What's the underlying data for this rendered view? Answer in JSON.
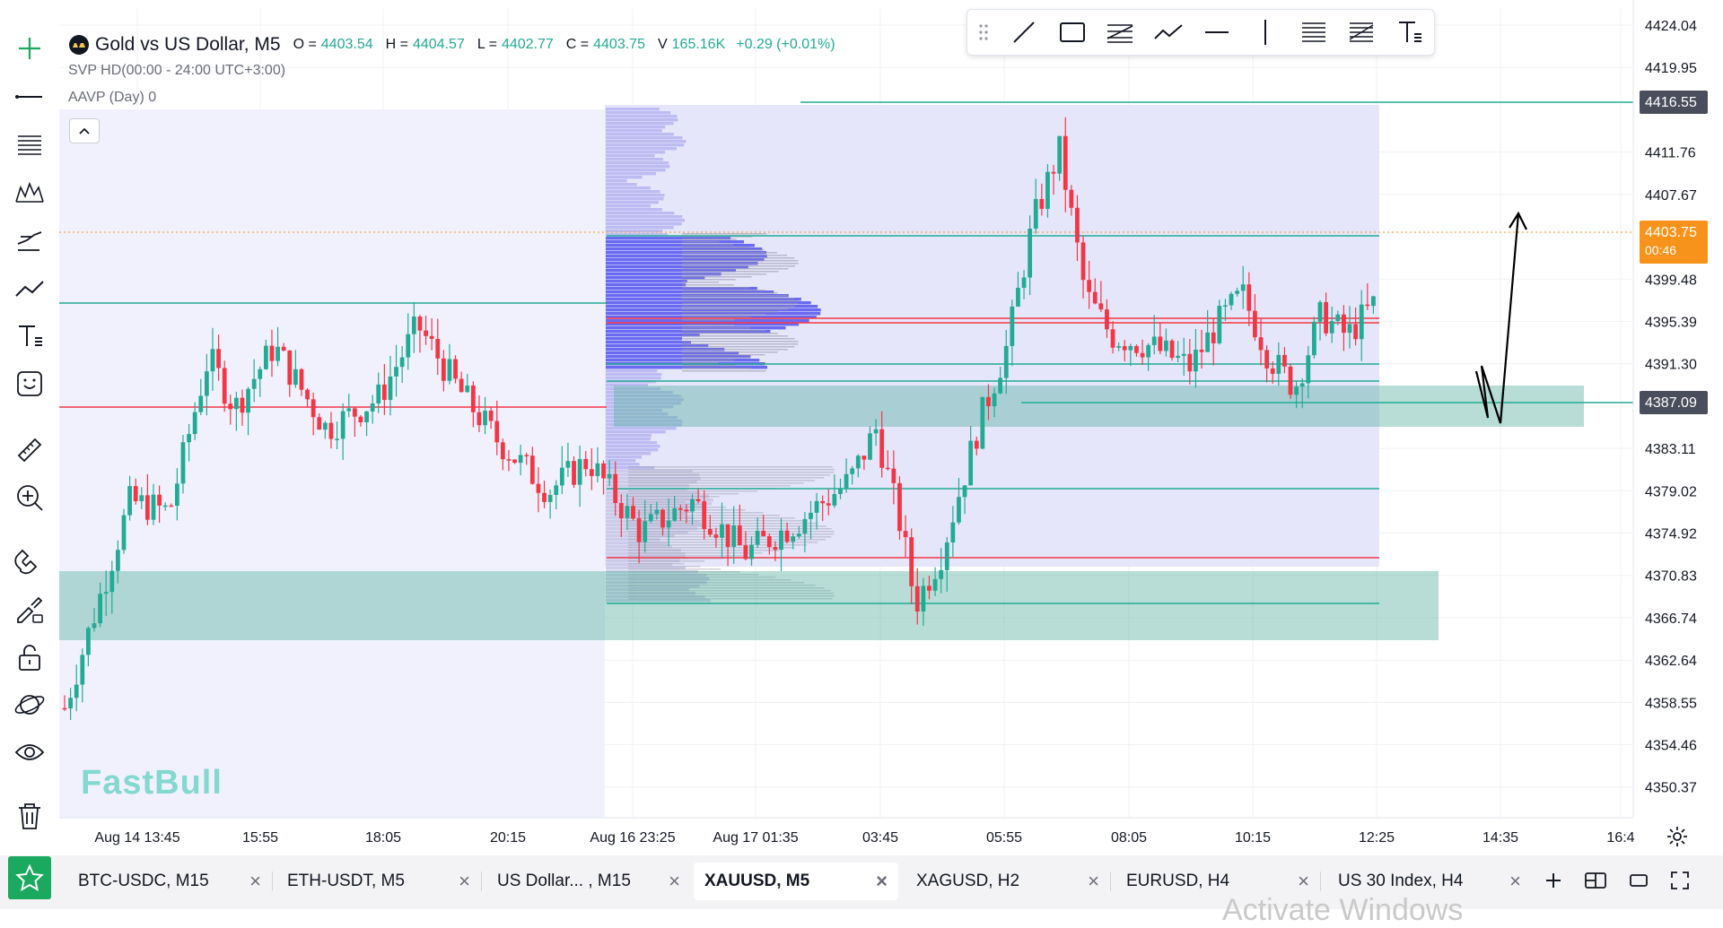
{
  "header": {
    "title": "Gold vs US Dollar, M5",
    "ohlc": [
      {
        "label": "O =",
        "value": "4403.54"
      },
      {
        "label": "H =",
        "value": "4404.57"
      },
      {
        "label": "L =",
        "value": "4402.77"
      },
      {
        "label": "C =",
        "value": "4403.75"
      },
      {
        "label": "V",
        "value": "165.16K"
      }
    ],
    "change": "+0.29 (+0.01%)",
    "indicators": [
      "SVP HD(00:00 - 24:00 UTC+3:00)",
      "AAVP (Day)  0"
    ]
  },
  "chart_data": {
    "type": "candlestick",
    "title": "Gold vs US Dollar, M5",
    "symbol": "XAUUSD",
    "timeframe": "M5",
    "y_ticks": [
      "4424.04",
      "4419.95",
      "4411.76",
      "4407.67",
      "4399.48",
      "4395.39",
      "4391.30",
      "4383.11",
      "4379.02",
      "4374.92",
      "4370.83",
      "4366.74",
      "4362.64",
      "4358.55",
      "4354.46",
      "4350.37"
    ],
    "x_ticks": [
      "Aug 14 13:45",
      "15:55",
      "18:05",
      "20:15",
      "Aug 16 23:25",
      "Aug 17 01:35",
      "03:45",
      "05:55",
      "08:05",
      "10:15",
      "12:25",
      "14:35",
      "16:4"
    ],
    "price_labels": [
      {
        "value": "4416.55",
        "color": "#4a4e5c"
      },
      {
        "value": "4403.75",
        "sub": "00:46",
        "color": "#f7931a"
      },
      {
        "value": "4387.09",
        "color": "#4a4e5c"
      }
    ],
    "ylim": [
      4347.4,
      4425.6
    ],
    "candles_approx": [
      {
        "x": 0.0,
        "price": 4358
      },
      {
        "x": 0.02,
        "price": 4366
      },
      {
        "x": 0.05,
        "price": 4378
      },
      {
        "x": 0.08,
        "price": 4377
      },
      {
        "x": 0.11,
        "price": 4392
      },
      {
        "x": 0.13,
        "price": 4387
      },
      {
        "x": 0.16,
        "price": 4393
      },
      {
        "x": 0.2,
        "price": 4385
      },
      {
        "x": 0.24,
        "price": 4388
      },
      {
        "x": 0.27,
        "price": 4395
      },
      {
        "x": 0.3,
        "price": 4389
      },
      {
        "x": 0.33,
        "price": 4384
      },
      {
        "x": 0.37,
        "price": 4379
      },
      {
        "x": 0.4,
        "price": 4382
      },
      {
        "x": 0.44,
        "price": 4375
      },
      {
        "x": 0.48,
        "price": 4378
      },
      {
        "x": 0.52,
        "price": 4373
      },
      {
        "x": 0.56,
        "price": 4376
      },
      {
        "x": 0.6,
        "price": 4380
      },
      {
        "x": 0.62,
        "price": 4385
      },
      {
        "x": 0.64,
        "price": 4375
      },
      {
        "x": 0.65,
        "price": 4368
      },
      {
        "x": 0.67,
        "price": 4373
      },
      {
        "x": 0.7,
        "price": 4386
      },
      {
        "x": 0.72,
        "price": 4393
      },
      {
        "x": 0.74,
        "price": 4405
      },
      {
        "x": 0.76,
        "price": 4412
      },
      {
        "x": 0.78,
        "price": 4398
      },
      {
        "x": 0.8,
        "price": 4394
      },
      {
        "x": 0.83,
        "price": 4393
      },
      {
        "x": 0.86,
        "price": 4391
      },
      {
        "x": 0.88,
        "price": 4395
      },
      {
        "x": 0.9,
        "price": 4398
      },
      {
        "x": 0.92,
        "price": 4392
      },
      {
        "x": 0.94,
        "price": 4389
      },
      {
        "x": 0.96,
        "price": 4396
      },
      {
        "x": 0.98,
        "price": 4394
      },
      {
        "x": 1.0,
        "price": 4397
      }
    ],
    "candles_approx_note": "",
    "legend_position": "top-left",
    "grid": true
  },
  "watermark": "FastBull",
  "tabs": [
    {
      "label": "BTC-USDC, M15",
      "active": false
    },
    {
      "label": "ETH-USDT, M5",
      "active": false
    },
    {
      "label": "US Dollar... , M15",
      "active": false
    },
    {
      "label": "XAUUSD, M5",
      "active": true
    },
    {
      "label": "XAGUSD, H2",
      "active": false
    },
    {
      "label": "EURUSD, H4",
      "active": false
    },
    {
      "label": "US 30 Index, H4",
      "active": false
    }
  ],
  "tab_close": "×",
  "os_overlay": "Activate Windows",
  "colors": {
    "up": "#22ab94",
    "down": "#f23645",
    "accent": "#f7931a",
    "zone": "#5fb3a3",
    "profile": "#5b5bf0",
    "star": "#1ba85f"
  },
  "icons": {
    "left_toolbar": [
      "plus-icon",
      "horizontal-line-icon",
      "fib-lines-icon",
      "pattern-icon",
      "forecast-icon",
      "trend-line-icon",
      "text-icon",
      "sticker-icon",
      "ruler-icon",
      "zoom-in-icon",
      "magnet-icon",
      "brush-lock-icon",
      "unlock-icon",
      "planet-icon",
      "eye-icon",
      "trash-icon"
    ],
    "draw_toolbar": [
      "drag-handle-icon",
      "line-icon",
      "rectangle-icon",
      "parallel-channel-icon",
      "path-icon",
      "horizontal-ray-icon",
      "vertical-line-icon",
      "fib-retracement-icon",
      "fib-extension-icon",
      "text-tool-icon"
    ]
  }
}
